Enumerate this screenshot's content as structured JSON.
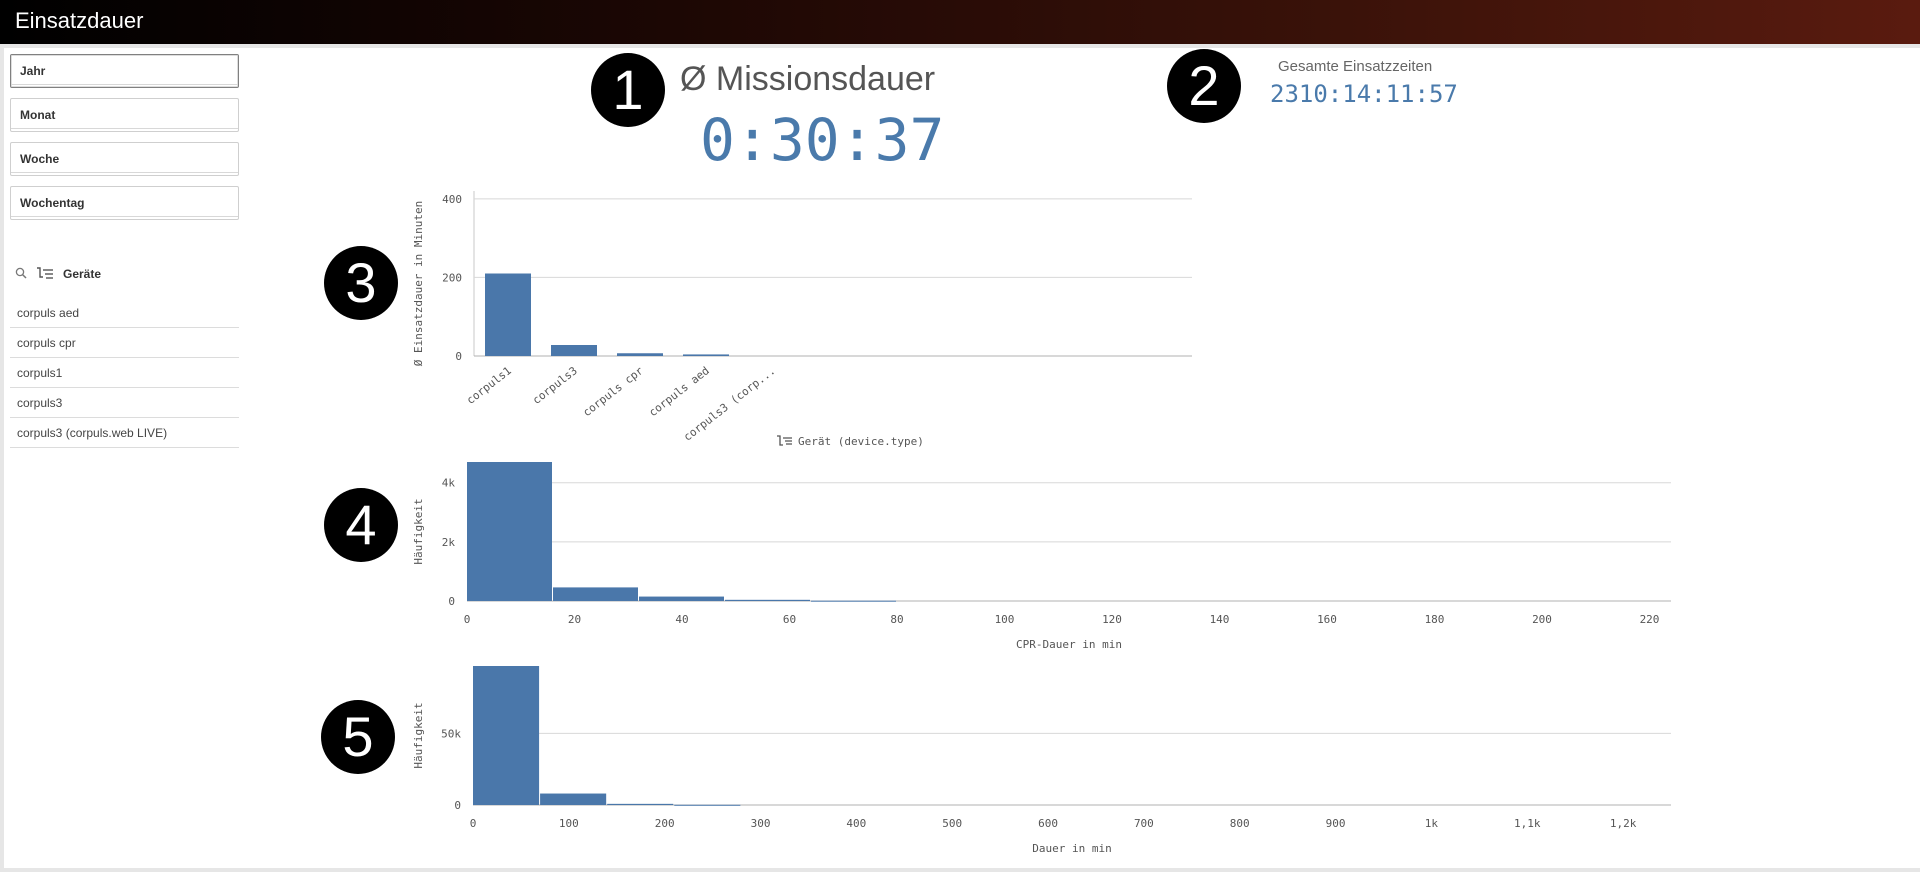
{
  "app": {
    "title": "Einsatzdauer"
  },
  "filters": [
    {
      "label": "Jahr"
    },
    {
      "label": "Monat"
    },
    {
      "label": "Woche"
    },
    {
      "label": "Wochentag"
    }
  ],
  "geraete": {
    "title": "Geräte",
    "items": [
      "corpuls aed",
      "corpuls cpr",
      "corpuls1",
      "corpuls3",
      "corpuls3 (corpuls.web LIVE)"
    ]
  },
  "markers": [
    "1",
    "2",
    "3",
    "4",
    "5"
  ],
  "kpi_mission": {
    "title": "Ø Missionsdauer",
    "value": "0:30:37"
  },
  "kpi_total": {
    "title": "Gesamte Einsatzzeiten",
    "value": "2310:14:11:57"
  },
  "colors": {
    "bar": "#4a77aa",
    "kpi": "#4a7aab",
    "header_start": "#000000",
    "header_end": "#5a1b0f"
  },
  "chart_data": [
    {
      "type": "bar",
      "title": "",
      "ylabel": "Ø Einsatzdauer in Minuten",
      "xlabel": "Gerät (device.type)",
      "categories": [
        "corpuls1",
        "corpuls3",
        "corpuls cpr",
        "corpuls aed",
        "corpuls3 (corp..."
      ],
      "values": [
        210,
        28,
        7,
        4,
        0
      ],
      "ylim": [
        0,
        420
      ],
      "yticks": [
        0,
        200,
        400
      ],
      "grid": true
    },
    {
      "type": "bar",
      "title": "",
      "ylabel": "Häufigkeit",
      "xlabel": "CPR-Dauer in min",
      "bins": [
        [
          0,
          16
        ],
        [
          16,
          32
        ],
        [
          32,
          48
        ],
        [
          48,
          64
        ],
        [
          64,
          80
        ]
      ],
      "values": [
        4700,
        460,
        150,
        40,
        10
      ],
      "xlim": [
        0,
        224
      ],
      "ylim": [
        0,
        4700
      ],
      "xticks": [
        0,
        20,
        40,
        60,
        80,
        100,
        120,
        140,
        160,
        180,
        200,
        220
      ],
      "xtick_labels": [
        "0",
        "20",
        "40",
        "60",
        "80",
        "100",
        "120",
        "140",
        "160",
        "180",
        "200",
        "220"
      ],
      "yticks": [
        0,
        2000,
        4000
      ],
      "ytick_labels": [
        "0",
        "2k",
        "4k"
      ],
      "grid": true
    },
    {
      "type": "bar",
      "title": "",
      "ylabel": "Häufigkeit",
      "xlabel": "Dauer in min",
      "bins": [
        [
          0,
          70
        ],
        [
          70,
          140
        ],
        [
          140,
          210
        ],
        [
          210,
          280
        ]
      ],
      "values": [
        97000,
        8000,
        800,
        150
      ],
      "xlim": [
        0,
        1250
      ],
      "ylim": [
        0,
        97000
      ],
      "xticks": [
        0,
        100,
        200,
        300,
        400,
        500,
        600,
        700,
        800,
        900,
        1000,
        1100,
        1200
      ],
      "xtick_labels": [
        "0",
        "100",
        "200",
        "300",
        "400",
        "500",
        "600",
        "700",
        "800",
        "900",
        "1k",
        "1,1k",
        "1,2k"
      ],
      "yticks": [
        0,
        50000
      ],
      "ytick_labels": [
        "0",
        "50k"
      ],
      "grid": true
    }
  ]
}
